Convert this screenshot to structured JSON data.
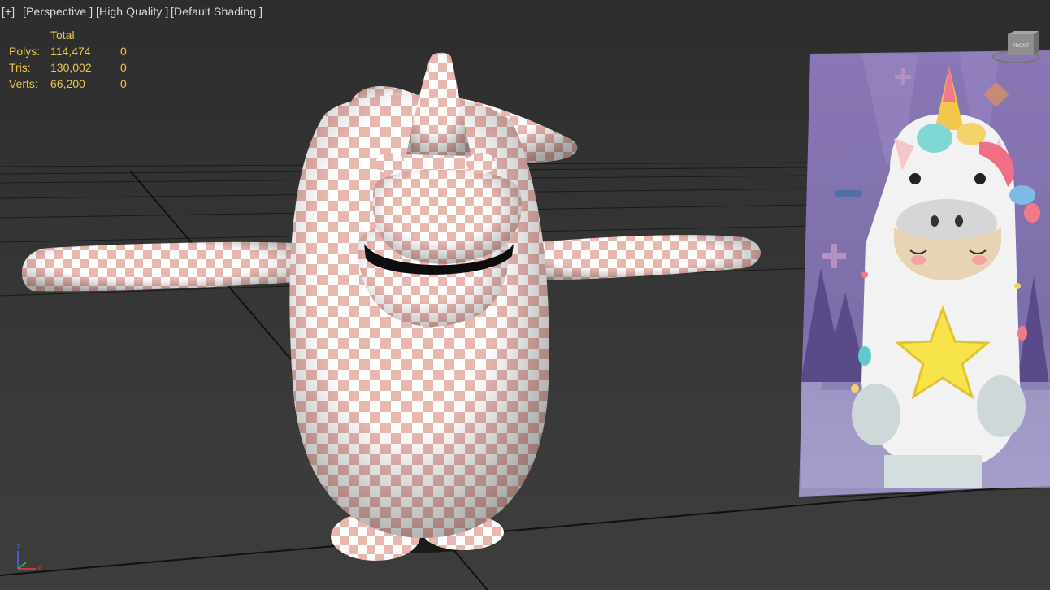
{
  "viewport": {
    "labels": {
      "plus": "[+]",
      "view": "[Perspective ]",
      "quality": "[High Quality ]",
      "shading": "[Default Shading ]"
    },
    "stats": {
      "header": "Total",
      "rows": [
        {
          "key": "Polys:",
          "value": "114,474",
          "selected": "0"
        },
        {
          "key": "Tris:",
          "value": "130,002",
          "selected": "0"
        },
        {
          "key": "Verts:",
          "value": "66,200",
          "selected": "0"
        }
      ]
    },
    "viewcube": {
      "face_label": "FRONT"
    },
    "axis": {
      "z": "z",
      "x": "x"
    }
  },
  "colors": {
    "background": "#363636",
    "stats_text": "#e7c84a",
    "label_text": "#d8d8d8",
    "checker_pink": "#eab7b0",
    "checker_white": "#ffffff",
    "poster_purple": "#7b6fa8"
  }
}
